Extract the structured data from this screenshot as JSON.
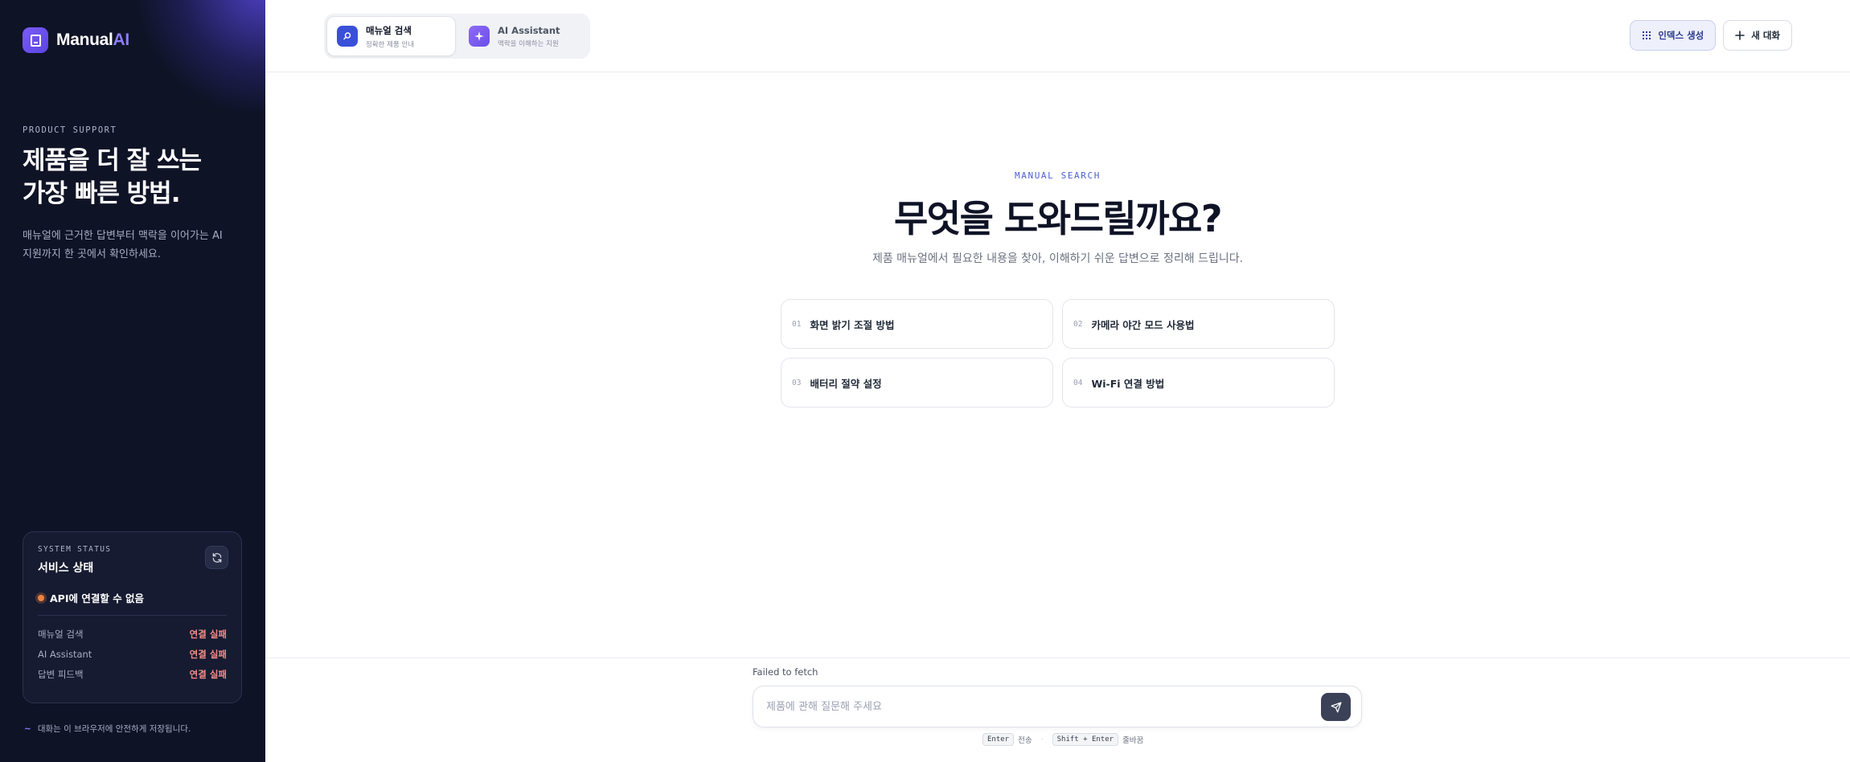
{
  "brand": {
    "name_main": "Manual",
    "name_accent": "AI"
  },
  "sidebar": {
    "eyebrow": "PRODUCT SUPPORT",
    "title_line1": "제품을 더 잘 쓰는",
    "title_line2": "가장 빠른 방법.",
    "description": "매뉴얼에 근거한 답변부터 맥락을 이어가는 AI 지원까지 한 곳에서 확인하세요.",
    "status": {
      "eyebrow": "SYSTEM STATUS",
      "title": "서비스 상태",
      "message": "API에 연결할 수 없음",
      "services": [
        {
          "name": "매뉴얼 검색",
          "state": "연결 실패"
        },
        {
          "name": "AI Assistant",
          "state": "연결 실패"
        },
        {
          "name": "답변 피드백",
          "state": "연결 실패"
        }
      ]
    },
    "footnote": "대화는 이 브라우저에 안전하게 저장됩니다."
  },
  "tabs": [
    {
      "label": "매뉴얼 검색",
      "sub": "정확한 제품 안내",
      "icon": "search-icon"
    },
    {
      "label": "AI Assistant",
      "sub": "맥락을 이해하는 지원",
      "icon": "sparkle-icon"
    }
  ],
  "toolbar": {
    "index_label": "인덱스 생성",
    "new_chat_label": "새 대화"
  },
  "main": {
    "eyebrow": "MANUAL SEARCH",
    "title": "무엇을 도와드릴까요?",
    "subtitle": "제품 매뉴얼에서 필요한 내용을 찾아, 이해하기 쉬운 답변으로 정리해 드립니다.",
    "suggestions": [
      {
        "num": "01",
        "label": "화면 밝기 조절 방법"
      },
      {
        "num": "02",
        "label": "카메라 야간 모드 사용법"
      },
      {
        "num": "03",
        "label": "배터리 절약 설정"
      },
      {
        "num": "04",
        "label": "Wi-Fi 연결 방법"
      }
    ]
  },
  "composer": {
    "error": "Failed to fetch",
    "placeholder": "제품에 관해 질문해 주세요",
    "hint_send_key": "Enter",
    "hint_send_label": "전송",
    "hint_newline_key": "Shift + Enter",
    "hint_newline_label": "줄바꿈"
  },
  "colors": {
    "sidebar_bg": "#0f1326",
    "accent": "#8b7cf8",
    "primary_blue": "#3a50d8",
    "error": "#f48c85",
    "status_dot": "#f0823e"
  }
}
